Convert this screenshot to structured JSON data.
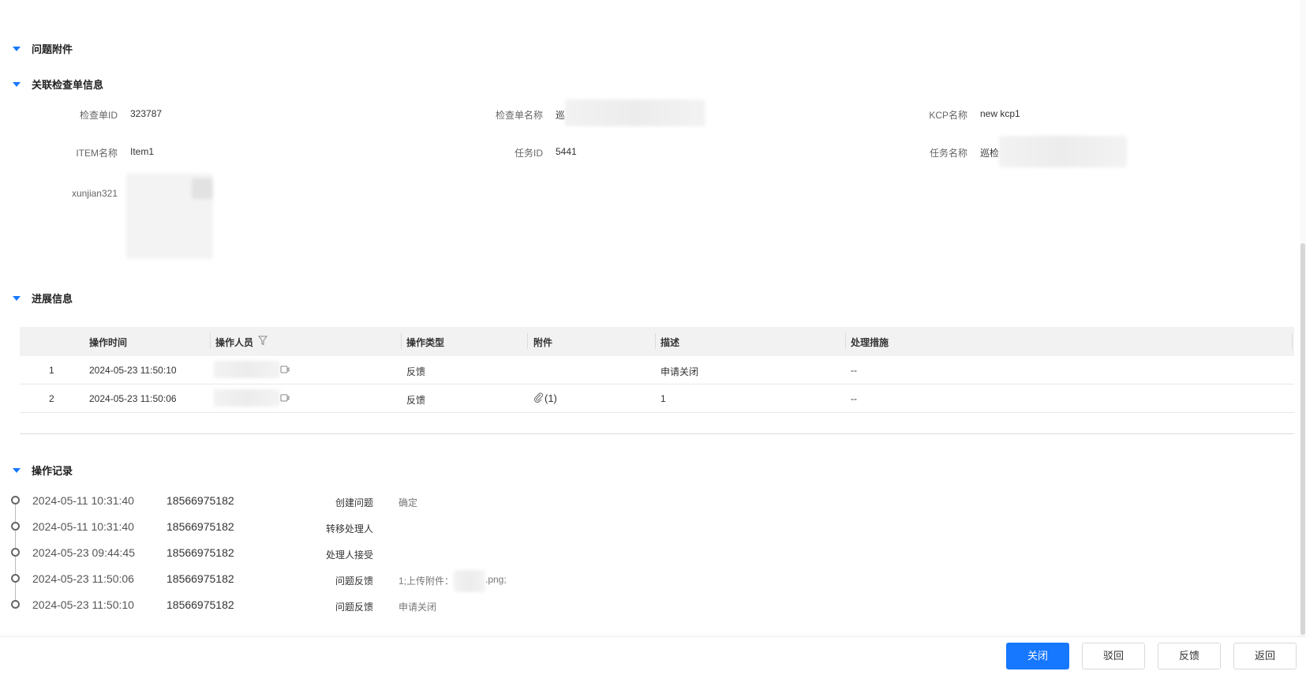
{
  "sections": {
    "attachments_title": "问题附件",
    "linked_checklist_title": "关联检查单信息",
    "progress_title": "进展信息",
    "operation_log_title": "操作记录"
  },
  "checklist": {
    "id_label": "检查单ID",
    "id_value": "323787",
    "name_label": "检查单名称",
    "name_value": "巡",
    "kcp_label": "KCP名称",
    "kcp_value": "new kcp1",
    "item_label": "ITEM名称",
    "item_value": "Item1",
    "task_id_label": "任务ID",
    "task_id_value": "5441",
    "task_name_label": "任务名称",
    "task_name_value": "巡检",
    "extra_label": "xunjian321"
  },
  "progress_table": {
    "headers": [
      "操作时间",
      "操作人员",
      "操作类型",
      "附件",
      "描述",
      "处理措施"
    ],
    "rows": [
      {
        "index": "1",
        "time": "2024-05-23 11:50:10",
        "type": "反馈",
        "attachment": "",
        "desc": "申请关闭",
        "measure": "--"
      },
      {
        "index": "2",
        "time": "2024-05-23 11:50:06",
        "type": "反馈",
        "attachment": "(1)",
        "desc": "1",
        "measure": "--"
      }
    ]
  },
  "operation_log": [
    {
      "time": "2024-05-11 10:31:40",
      "user": "18566975182",
      "action": "创建问题",
      "note": "确定"
    },
    {
      "time": "2024-05-11 10:31:40",
      "user": "18566975182",
      "action": "转移处理人",
      "note": ""
    },
    {
      "time": "2024-05-23 09:44:45",
      "user": "18566975182",
      "action": "处理人接受",
      "note": ""
    },
    {
      "time": "2024-05-23 11:50:06",
      "user": "18566975182",
      "action": "问题反馈",
      "note": "1;上传附件：",
      "note_suffix": ".png;"
    },
    {
      "time": "2024-05-23 11:50:10",
      "user": "18566975182",
      "action": "问题反馈",
      "note": "申请关闭"
    }
  ],
  "footer": {
    "close": "关闭",
    "reject": "驳回",
    "feedback": "反馈",
    "back": "返回"
  },
  "colors": {
    "accent": "#1677ff"
  }
}
